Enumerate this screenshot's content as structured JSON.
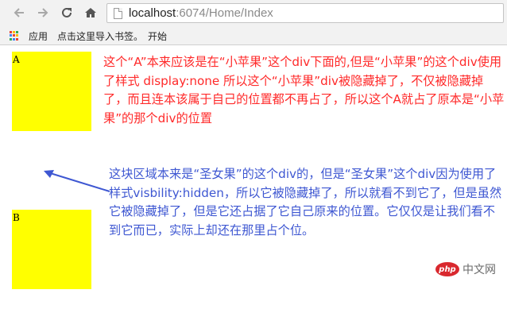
{
  "toolbar": {
    "back_icon": "arrow-left-icon",
    "forward_icon": "arrow-right-icon",
    "reload_icon": "reload-icon",
    "home_icon": "home-icon",
    "url_host": "localhost",
    "url_rest": ":6074/Home/Index"
  },
  "bookmarks": {
    "apps_label": "应用",
    "import_label": "点击这里导入书签。",
    "start_label": "开始"
  },
  "content": {
    "box_a_label": "A",
    "box_b_label": "B",
    "red_note": "这个“A”本来应该是在“小苹果”这个div下面的,但是“小苹果”的这个div使用了样式 display:none 所以这个“小苹果”div被隐藏掉了，不仅被隐藏掉了，而且连本该属于自己的位置都不再占了，所以这个A就占了原本是“小苹果”的那个div的位置",
    "blue_note": "这块区域本来是“圣女果”的这个div的，但是“圣女果”这个div因为使用了样式visbility:hidden，所以它被隐藏掉了，所以就看不到它了，但是虽然它被隐藏掉了，但是它还占据了它自己原来的位置。它仅仅是让我们看不到它而已，实际上却还在那里占个位。",
    "box_color": "#ffff00",
    "red_color": "#ff2a2a",
    "blue_color": "#3e57d2"
  },
  "watermark": {
    "logo_text": "php",
    "site_text": "中文网"
  }
}
